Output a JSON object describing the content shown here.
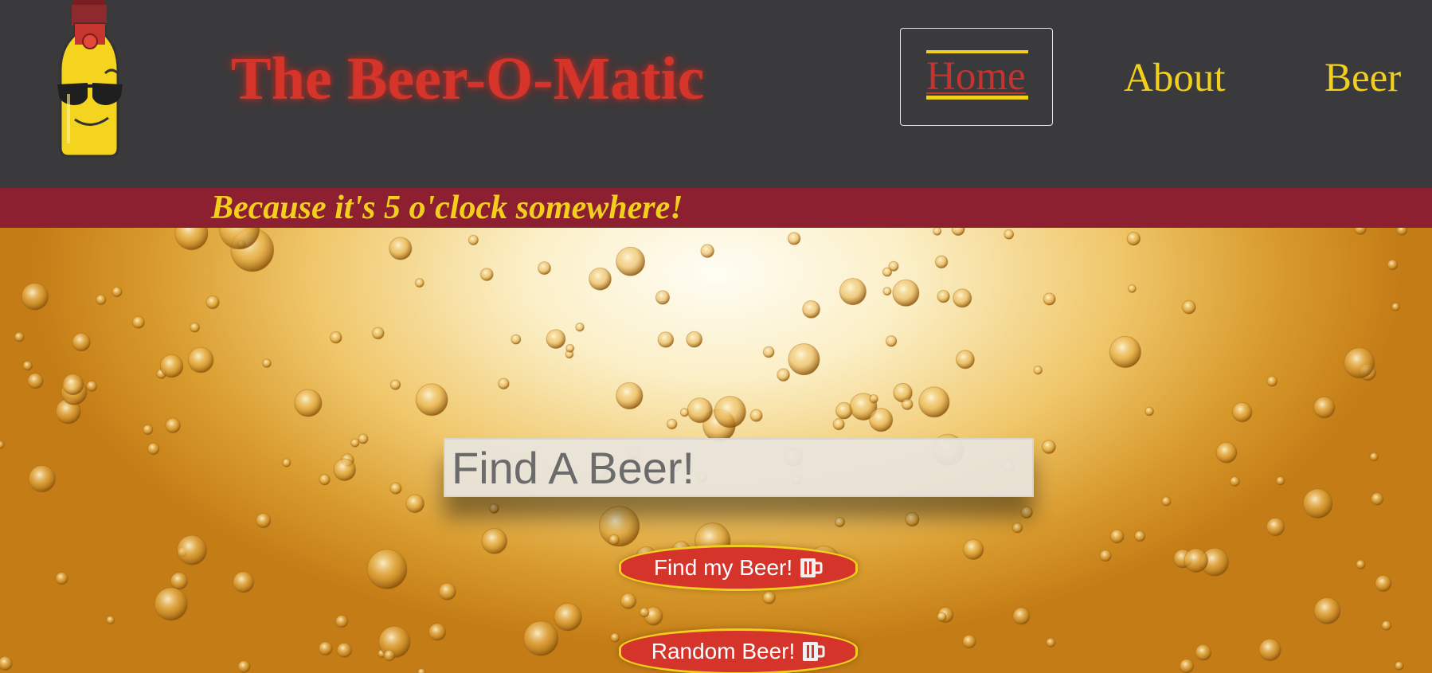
{
  "header": {
    "title": "The Beer-O-Matic",
    "logo_icon": "beer-bottle-sunglasses-icon"
  },
  "nav": {
    "home": "Home",
    "about": "About",
    "beer": "Beer"
  },
  "tagline": "Because it's 5 o'clock somewhere!",
  "search": {
    "placeholder": "Find A Beer!",
    "value": ""
  },
  "buttons": {
    "find": "Find my Beer!",
    "random": "Random Beer!",
    "icon": "beer-mug-icon"
  },
  "colors": {
    "header_bg": "#3a3a3c",
    "title_red": "#d4342a",
    "nav_yellow": "#f2cf1c",
    "tagline_band": "#8d2030",
    "button_red": "#d4342a"
  }
}
